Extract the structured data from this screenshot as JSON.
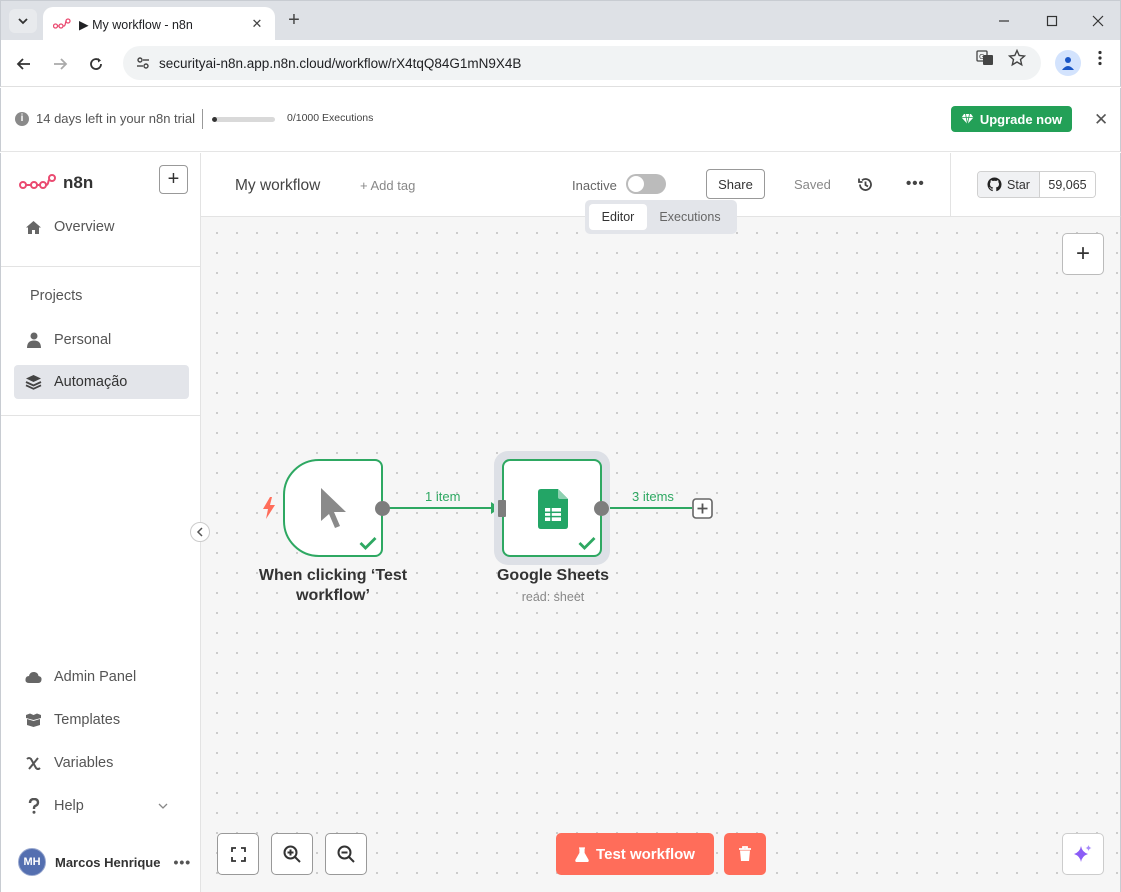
{
  "browser": {
    "tab_title": "▶ My workflow - n8n",
    "tab_close": "✕",
    "new_tab": "+",
    "url": "securityai-n8n.app.n8n.cloud/workflow/rX4tqQ84G1mN9X4B"
  },
  "banner": {
    "trial_text": "14 days left in your n8n trial",
    "executions_text": "0/1000 Executions",
    "executions_progress": 0.0,
    "upgrade_label": "Upgrade now",
    "close": "✕"
  },
  "sidebar": {
    "logo_text": "n8n",
    "add_label": "+",
    "overview_label": "Overview",
    "projects_title": "Projects",
    "personal_label": "Personal",
    "project_label": "Automação",
    "admin_label": "Admin Panel",
    "templates_label": "Templates",
    "variables_label": "Variables",
    "help_label": "Help",
    "user_initials": "MH",
    "user_name": "Marcos Henrique",
    "user_more": "•••"
  },
  "header": {
    "workflow_name": "My workflow",
    "add_tag": "+ Add tag",
    "status_label": "Inactive",
    "share_label": "Share",
    "saved_label": "Saved",
    "more": "•••",
    "star_label": "Star",
    "star_count": "59,065"
  },
  "view_tabs": {
    "editor": "Editor",
    "executions": "Executions"
  },
  "nodes": {
    "trigger_label": "When clicking ‘Test workflow’",
    "gs_label": "Google Sheets",
    "gs_sub": "read: sheet",
    "edge1_label": "1 item",
    "edge2_label": "3 items"
  },
  "canvas": {
    "plus": "+",
    "test_label": "Test workflow"
  },
  "colors": {
    "brand": "#ea4b71",
    "success": "#2ea862",
    "test_button": "#ff6d5a",
    "upgrade": "#23a057"
  }
}
